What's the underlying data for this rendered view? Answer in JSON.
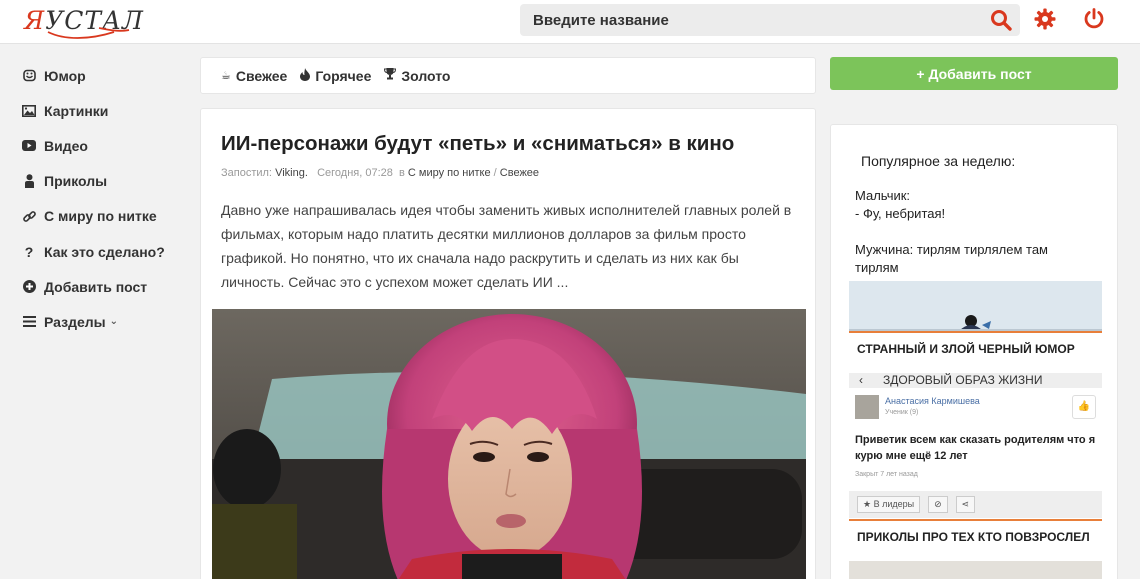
{
  "logo": {
    "prefix": "Я",
    "rest": "УСТАЛ"
  },
  "search": {
    "placeholder": "Введите название"
  },
  "icons": {
    "search": "search-icon",
    "settings": "gear-icon",
    "logout": "power-icon"
  },
  "colors": {
    "accent": "#d9381e",
    "add_button": "#7cc45a",
    "thumb_border": "#e87f3a"
  },
  "sidebar": {
    "items": [
      {
        "label": "Юмор",
        "icon": "smile-icon"
      },
      {
        "label": "Картинки",
        "icon": "picture-icon"
      },
      {
        "label": "Видео",
        "icon": "video-icon"
      },
      {
        "label": "Приколы",
        "icon": "person-icon"
      },
      {
        "label": "С миру по нитке",
        "icon": "link-icon"
      },
      {
        "label": "Как это сделано?",
        "icon": "question-icon"
      },
      {
        "label": "Добавить пост",
        "icon": "plus-circle-icon"
      },
      {
        "label": "Разделы",
        "icon": "menu-icon"
      }
    ]
  },
  "tabs": [
    {
      "label": "Свежее",
      "icon": "fresh-icon"
    },
    {
      "label": "Горячее",
      "icon": "fire-icon"
    },
    {
      "label": "Золото",
      "icon": "trophy-icon"
    }
  ],
  "article": {
    "title": "ИИ-персонажи будут «петь» и «сниматься» в кино",
    "meta": {
      "posted_label": "Запостил:",
      "author": "Viking.",
      "time": "Сегодня, 07:28",
      "in_label": "в",
      "category": "С миру по нитке",
      "separator": "/",
      "section": "Свежее"
    },
    "body": "Давно уже напрашивалась идея чтобы заменить живых исполнителей главных ролей в фильмах, которым надо платить десятки миллионов долларов за фильм просто графикой. Но понятно, что их сначала надо раскрутить и сделать из них как бы личность. Сейчас это с успехом может сделать ИИ ..."
  },
  "right": {
    "add_post_label": "+ Добавить пост",
    "popular_header": "Популярное за неделю:",
    "jokes": [
      {
        "line1": "Мальчик:",
        "line2": "- Фу, небритая!"
      },
      {
        "line1": "Мужчина: тирлям тирлялем там",
        "line2": "тирлям"
      }
    ],
    "posts": [
      {
        "title": "СТРАННЫЙ И ЗЛОЙ ЧЕРНЫЙ ЮМОР"
      },
      {
        "title": "ПРИКОЛЫ ПРО ТЕХ КТО ПОВЗРОСЛЕЛ"
      }
    ],
    "screenshot": {
      "header": "ЗДОРОВЫЙ ОБРАЗ ЖИЗНИ",
      "name": "Анастасия Кармишева",
      "sub": "Ученик (9)",
      "text": "Приветик всем как сказать родителям что я курю мне ещё 12 лет",
      "closed": "Закрыт 7 лет назад",
      "leaders": "В лидеры"
    }
  }
}
